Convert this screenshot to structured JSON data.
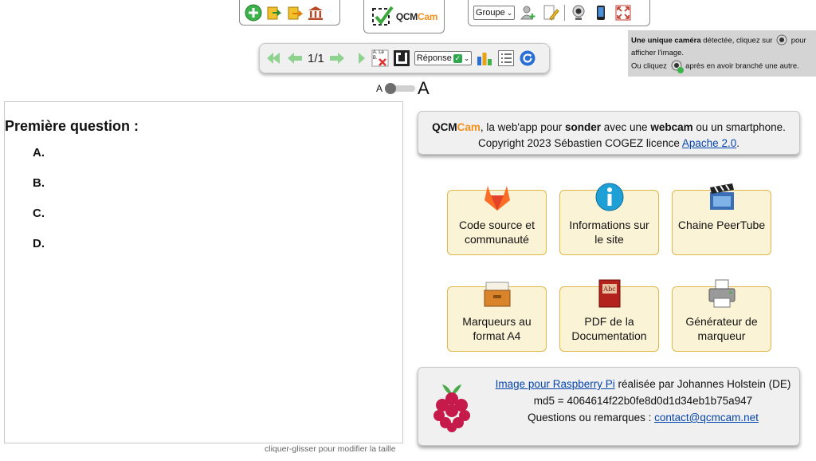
{
  "toolbar_left": {
    "icons": [
      "add-icon",
      "import-icon",
      "export-icon",
      "library-icon"
    ]
  },
  "logo": {
    "qcm": "QCM",
    "cam": "Cam"
  },
  "toolbar_right": {
    "group_select": "Groupe",
    "icons": [
      "add-user-icon",
      "edit-doc-icon",
      "webcam-icon",
      "smartphone-icon",
      "fullscreen-icon"
    ]
  },
  "nav": {
    "counter": "1/1",
    "mini_label_top": "A. Le",
    "mini_label_bottom": "B.",
    "answer_select": "Réponse"
  },
  "camera_info": {
    "line1_bold": "Une unique caméra",
    "line1_rest": " détectée, cliquez sur",
    "line1_end": " pour",
    "line2": "afficher l'image.",
    "line3_start": "Ou cliquez",
    "line3_end": " après en avoir branché une autre."
  },
  "font_size": {
    "small": "A",
    "big": "A"
  },
  "question": {
    "title": "Première question :",
    "answers": [
      "A.",
      "B.",
      "C.",
      "D."
    ],
    "resize_hint": "cliquer-glisser pour modifier la taille"
  },
  "about": {
    "qcm": "QCM",
    "cam": "Cam",
    "t1": ", la web'app pour ",
    "b1": "sonder",
    "t2": " avec une ",
    "b2": "webcam",
    "t3": " ou un smartphone.",
    "copyright": "Copyright 2023 Sébastien COGEZ licence ",
    "license_link": "Apache 2.0",
    "end": "."
  },
  "tiles": [
    {
      "label_1": "Code source et",
      "label_2": "communauté",
      "icon": "gitlab-icon"
    },
    {
      "label_1": "Informations sur",
      "label_2": "le site",
      "icon": "info-icon"
    },
    {
      "label_1": "Chaine PeerTube",
      "label_2": "",
      "icon": "clapperboard-icon"
    },
    {
      "label_1": "Marqueurs au",
      "label_2": "format A4",
      "icon": "drawer-icon"
    },
    {
      "label_1": "PDF de la",
      "label_2": "Documentation",
      "icon": "abc-book-icon"
    },
    {
      "label_1": "Générateur de",
      "label_2": "marqueur",
      "icon": "printer-icon"
    }
  ],
  "raspberry": {
    "link": "Image pour Raspberry Pi",
    "after_link": " réalisée par Johannes Holstein (DE)",
    "md5": "md5 = 4064614f22b0fe8d0d1d34eb1b75a947",
    "questions": "Questions ou remarques : ",
    "email": "contact@qcmcam.net"
  },
  "colors": {
    "accent_orange": "#f5901e",
    "tile_bg": "#fbf3d6",
    "tile_border": "#e0b84a",
    "link": "#0645ad"
  }
}
